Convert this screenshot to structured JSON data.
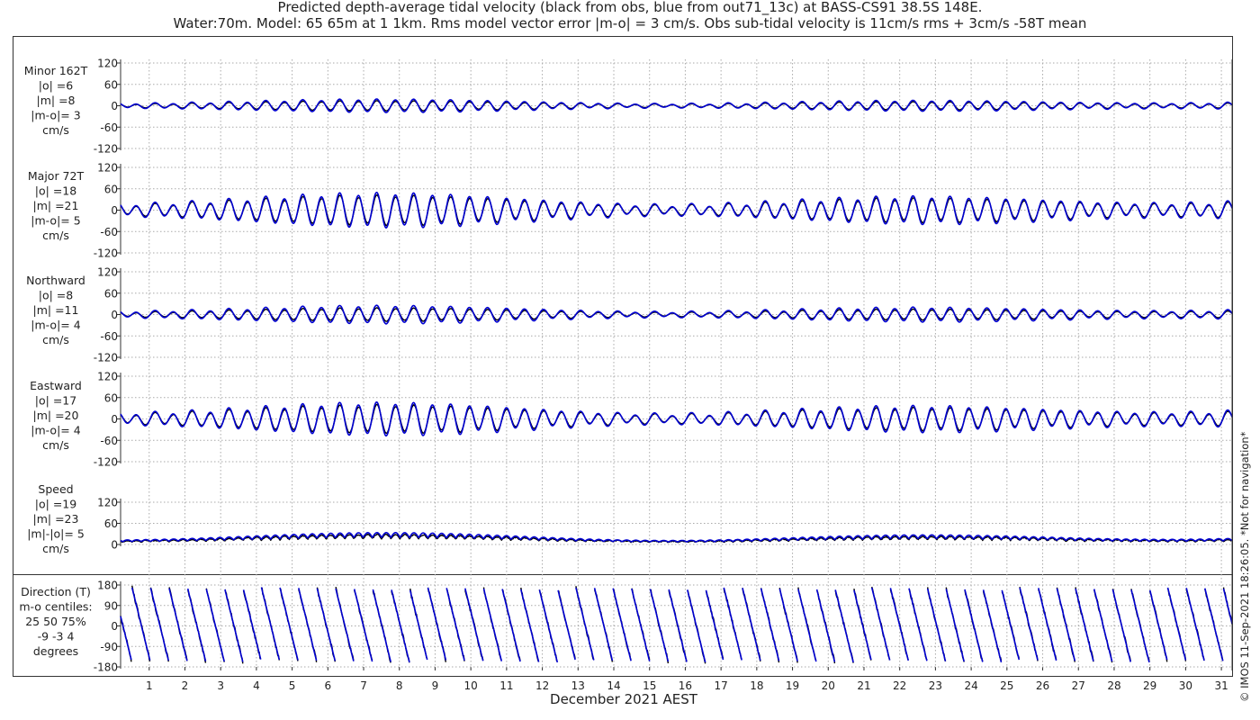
{
  "title": {
    "line1": "Predicted depth-average tidal velocity (black from obs, blue from out71_13c) at BASS-CS91 38.5S 148E.",
    "line2": "Water:70m. Model: 65 65m at 1 1km. Rms model vector error |m-o| = 3 cm/s. Obs sub-tidal velocity is 11cm/s rms + 3cm/s -58T mean"
  },
  "copyright": "© IMOS 11-Sep-2021 18:26:05. *Not for navigation*",
  "colors": {
    "obs": "#000000",
    "model": "#0000d0",
    "grid": "#aaaaaa",
    "axis": "#333333"
  },
  "chart_data": {
    "type": "line",
    "xlabel": "December 2021 AEST",
    "x_range_days": [
      0.2,
      31.3
    ],
    "x_ticks": [
      "1",
      "2",
      "3",
      "4",
      "5",
      "6",
      "7",
      "8",
      "9",
      "10",
      "11",
      "12",
      "13",
      "14",
      "15",
      "16",
      "17",
      "18",
      "19",
      "20",
      "21",
      "22",
      "23",
      "24",
      "25",
      "26",
      "27",
      "28",
      "29",
      "30",
      "31"
    ],
    "series_legend": [
      {
        "name": "obs",
        "color": "#000000"
      },
      {
        "name": "out71_13c",
        "color": "#0000d0"
      }
    ],
    "panels": [
      {
        "id": "minor",
        "label": [
          "Minor 162T",
          "|o| =6",
          "|m| =8",
          "|m-o|= 3",
          "cm/s"
        ],
        "ylim": [
          -120,
          120
        ],
        "yticks": [
          "120",
          "60",
          "0",
          "-60",
          "-120"
        ],
        "amp_obs": 6,
        "amp_model": 8,
        "offset": 0,
        "shape": "tide"
      },
      {
        "id": "major",
        "label": [
          "Major 72T",
          "|o| =18",
          "|m| =21",
          "|m-o|= 5",
          "cm/s"
        ],
        "ylim": [
          -120,
          120
        ],
        "yticks": [
          "120",
          "60",
          "0",
          "-60",
          "-120"
        ],
        "amp_obs": 18,
        "amp_model": 21,
        "offset": 0,
        "shape": "tide"
      },
      {
        "id": "north",
        "label": [
          "Northward",
          "|o| =8",
          "|m| =11",
          "|m-o|= 4",
          "cm/s"
        ],
        "ylim": [
          -120,
          120
        ],
        "yticks": [
          "120",
          "60",
          "0",
          "-60",
          "-120"
        ],
        "amp_obs": 8,
        "amp_model": 11,
        "offset": 0,
        "shape": "tide"
      },
      {
        "id": "east",
        "label": [
          "Eastward",
          "|o| =17",
          "|m| =20",
          "|m-o|= 4",
          "cm/s"
        ],
        "ylim": [
          -120,
          120
        ],
        "yticks": [
          "120",
          "60",
          "0",
          "-60",
          "-120"
        ],
        "amp_obs": 17,
        "amp_model": 20,
        "offset": 0,
        "shape": "tide"
      },
      {
        "id": "speed",
        "label": [
          "Speed",
          "|o| =19",
          "|m| =23",
          "|m|-|o|= 5",
          "cm/s"
        ],
        "ylim": [
          0,
          120
        ],
        "yticks": [
          "120",
          "60",
          "0"
        ],
        "amp_obs": 19,
        "amp_model": 23,
        "offset": 0,
        "shape": "speed"
      },
      {
        "id": "direction",
        "label": [
          "Direction (T)",
          "m-o centiles:",
          "25  50  75%",
          "-9 -3  4",
          "degrees"
        ],
        "ylim": [
          -180,
          180
        ],
        "yticks": [
          "180",
          "90",
          "0",
          "-90",
          "-180"
        ],
        "amp_obs": 180,
        "amp_model": 180,
        "offset": 0,
        "shape": "direction"
      }
    ]
  }
}
